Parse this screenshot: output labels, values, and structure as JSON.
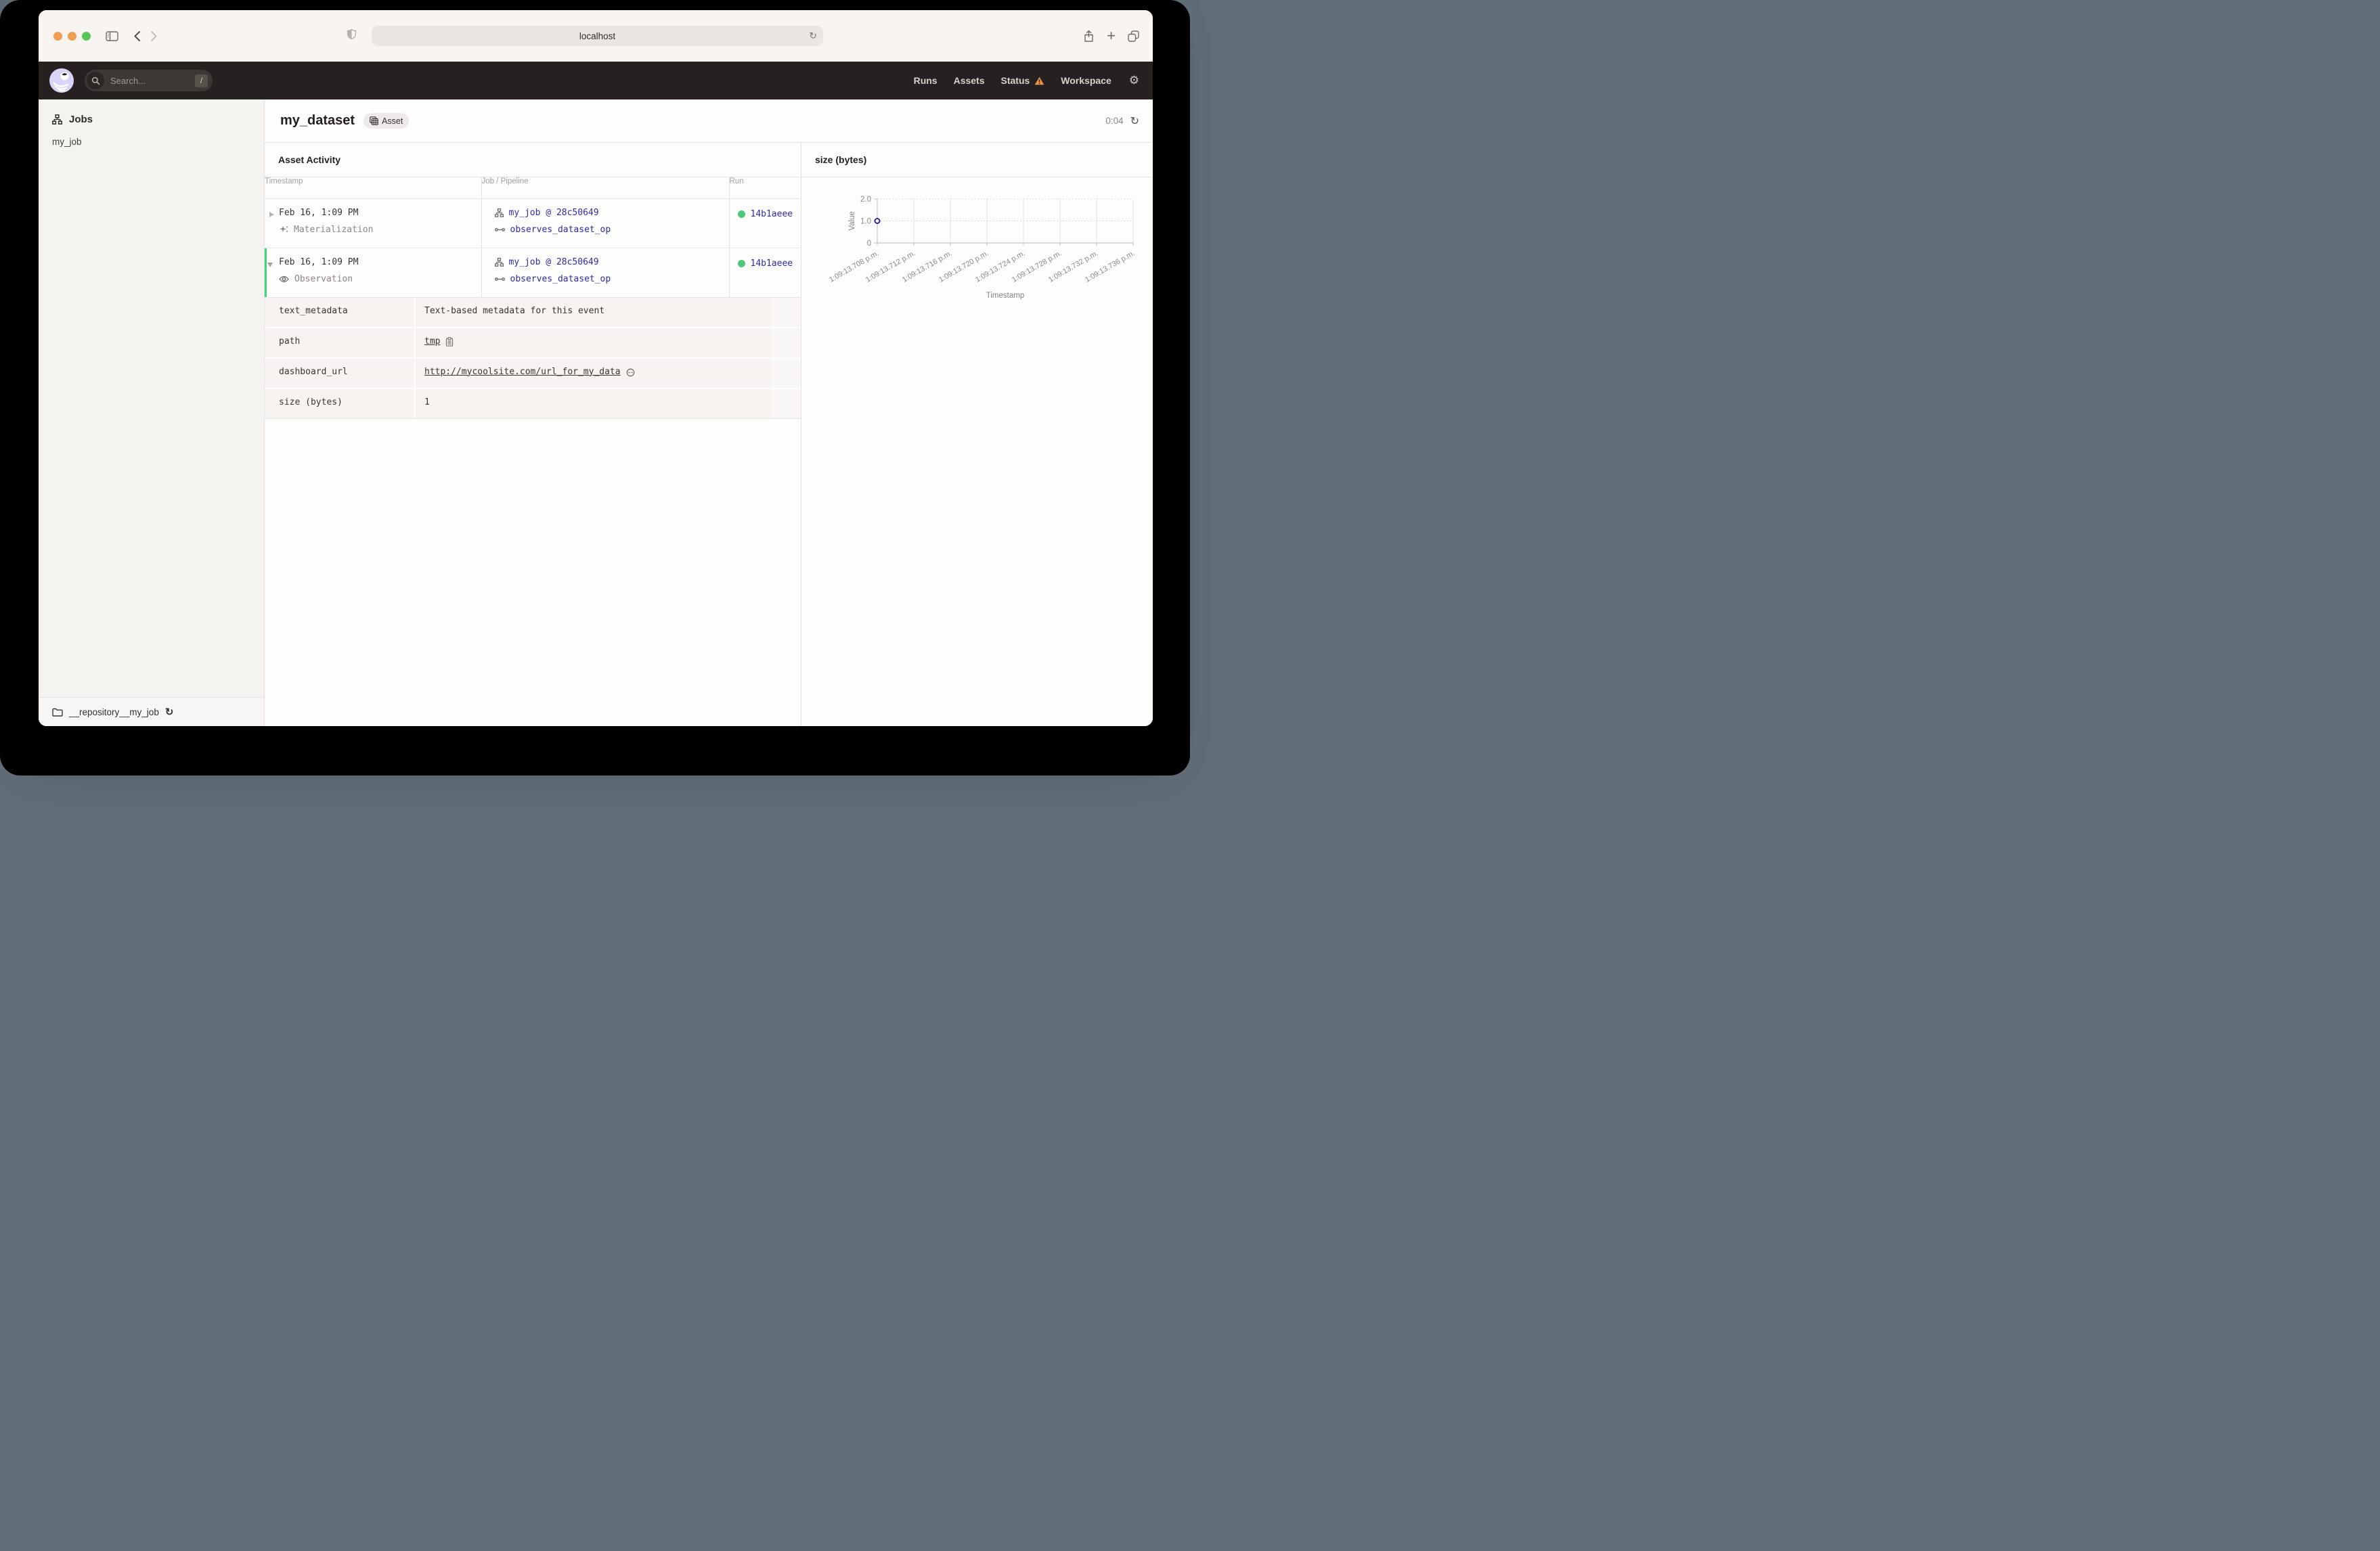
{
  "browser": {
    "url": "localhost",
    "traffic_lights": [
      "#EE9D51",
      "#EE9D51",
      "#58C558"
    ]
  },
  "app_header": {
    "search_placeholder": "Search...",
    "search_shortcut": "/",
    "nav": [
      {
        "label": "Runs",
        "warning": false
      },
      {
        "label": "Assets",
        "warning": false
      },
      {
        "label": "Status",
        "warning": true
      },
      {
        "label": "Workspace",
        "warning": false
      }
    ]
  },
  "sidebar": {
    "section_title": "Jobs",
    "items": [
      {
        "label": "my_job"
      }
    ],
    "repository": "__repository__my_job"
  },
  "main": {
    "title": "my_dataset",
    "tag": "Asset",
    "elapsed": "0:04",
    "activity": {
      "heading": "Asset Activity",
      "columns": [
        "Timestamp",
        "Job / Pipeline",
        "Run"
      ],
      "events": [
        {
          "timestamp": "Feb 16, 1:09 PM",
          "type": "Materialization",
          "job": "my_job @ 28c50649",
          "op": "observes_dataset_op",
          "run_id": "14b1aeee",
          "expanded": false
        },
        {
          "timestamp": "Feb 16, 1:09 PM",
          "type": "Observation",
          "job": "my_job @ 28c50649",
          "op": "observes_dataset_op",
          "run_id": "14b1aeee",
          "expanded": true
        }
      ],
      "metadata": [
        {
          "key": "text_metadata",
          "value": "Text-based metadata for this event"
        },
        {
          "key": "path",
          "value": "tmp"
        },
        {
          "key": "dashboard_url",
          "value": "http://mycoolsite.com/url_for_my_data"
        },
        {
          "key": "size (bytes)",
          "value": "1"
        }
      ]
    }
  },
  "chart_data": {
    "type": "scatter",
    "title": "size (bytes)",
    "xlabel": "Timestamp",
    "ylabel": "Value",
    "ylim": [
      0,
      2
    ],
    "y_ticks": [
      2.0,
      1.0,
      0
    ],
    "x_tick_labels": [
      "1:09:13.708 p.m.",
      "1:09:13.712 p.m.",
      "1:09:13.716 p.m.",
      "1:09:13.720 p.m.",
      "1:09:13.724 p.m.",
      "1:09:13.728 p.m.",
      "1:09:13.732 p.m.",
      "1:09:13.736 p.m."
    ],
    "grid": true,
    "points": [
      {
        "x_label": "1:09:13.708 p.m.",
        "x_index": 0,
        "y": 1
      }
    ]
  },
  "colors": {
    "link": "#2f2ba6",
    "run_success_green": "#4cc87c",
    "expanded_row_accent": "#3fd47f",
    "warning_orange": "#ED9444",
    "point_stroke": "#2b2aa0"
  }
}
